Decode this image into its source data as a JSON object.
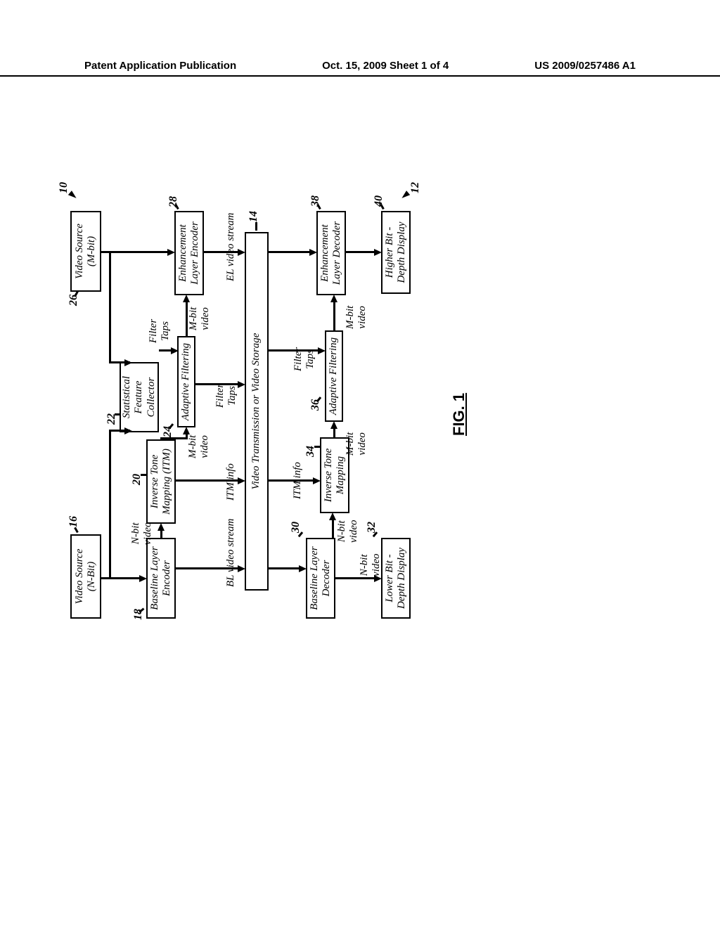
{
  "header": {
    "left": "Patent Application Publication",
    "middle": "Oct. 15, 2009  Sheet 1 of 4",
    "right": "US 2009/0257486 A1"
  },
  "fig_label": "FIG. 1",
  "refs": {
    "r10": "10",
    "r12": "12",
    "r14": "14",
    "r16": "16",
    "r18": "18",
    "r20": "20",
    "r22": "22",
    "r24": "24",
    "r26": "26",
    "r28": "28",
    "r30": "30",
    "r32": "32",
    "r34": "34",
    "r36": "36",
    "r38": "38",
    "r40": "40"
  },
  "boxes": {
    "video_source_n": {
      "l1": "Video Source",
      "l2": "(N-Bit)"
    },
    "bl_encoder": {
      "l1": "Baseline Layer",
      "l2": "Encoder"
    },
    "itm_enc": {
      "l1": "Inverse Tone",
      "l2": "Mapping  (ITM)"
    },
    "stat_feature": {
      "l1": "Statistical",
      "l2": "Feature",
      "l3": "Collector"
    },
    "adaptive_enc": "Adaptive Filtering",
    "video_source_m": {
      "l1": "Video Source",
      "l2": "(M-bit)"
    },
    "el_encoder": {
      "l1": "Enhancement",
      "l2": "Layer Encoder"
    },
    "transmission": "Video Transmission or Video Storage",
    "bl_decoder": {
      "l1": "Baseline Layer",
      "l2": "Decoder"
    },
    "itm_dec": {
      "l1": "Inverse Tone",
      "l2": "Mapping"
    },
    "adaptive_dec": "Adaptive Filtering",
    "el_decoder": {
      "l1": "Enhancement",
      "l2": "Layer Decoder"
    },
    "lower_display": {
      "l1": "Lower Bit -",
      "l2": "Depth Display"
    },
    "higher_display": {
      "l1": "Higher Bit -",
      "l2": "Depth Display"
    }
  },
  "edge_labels": {
    "nbit_video_1": "N-bit\nvideo",
    "bl_stream": "BL video stream",
    "itm_info_1": "ITM info",
    "mbit_video_1": "M-bit\nvideo",
    "filter_taps_1": "Filter\nTaps",
    "filter_taps_side": "Filter\nTaps",
    "mbit_video_2": "M-bit\nvideo",
    "el_stream": "EL video stream",
    "nbit_video_2": "N-bit\nvideo",
    "nbit_video_3": "N-bit\nvideo",
    "itm_info_2": "ITM info",
    "mbit_video_3": "M-bit\nvideo",
    "filter_taps_2": "Filter\nTaps",
    "mbit_video_4": "M-bit\nvideo"
  }
}
